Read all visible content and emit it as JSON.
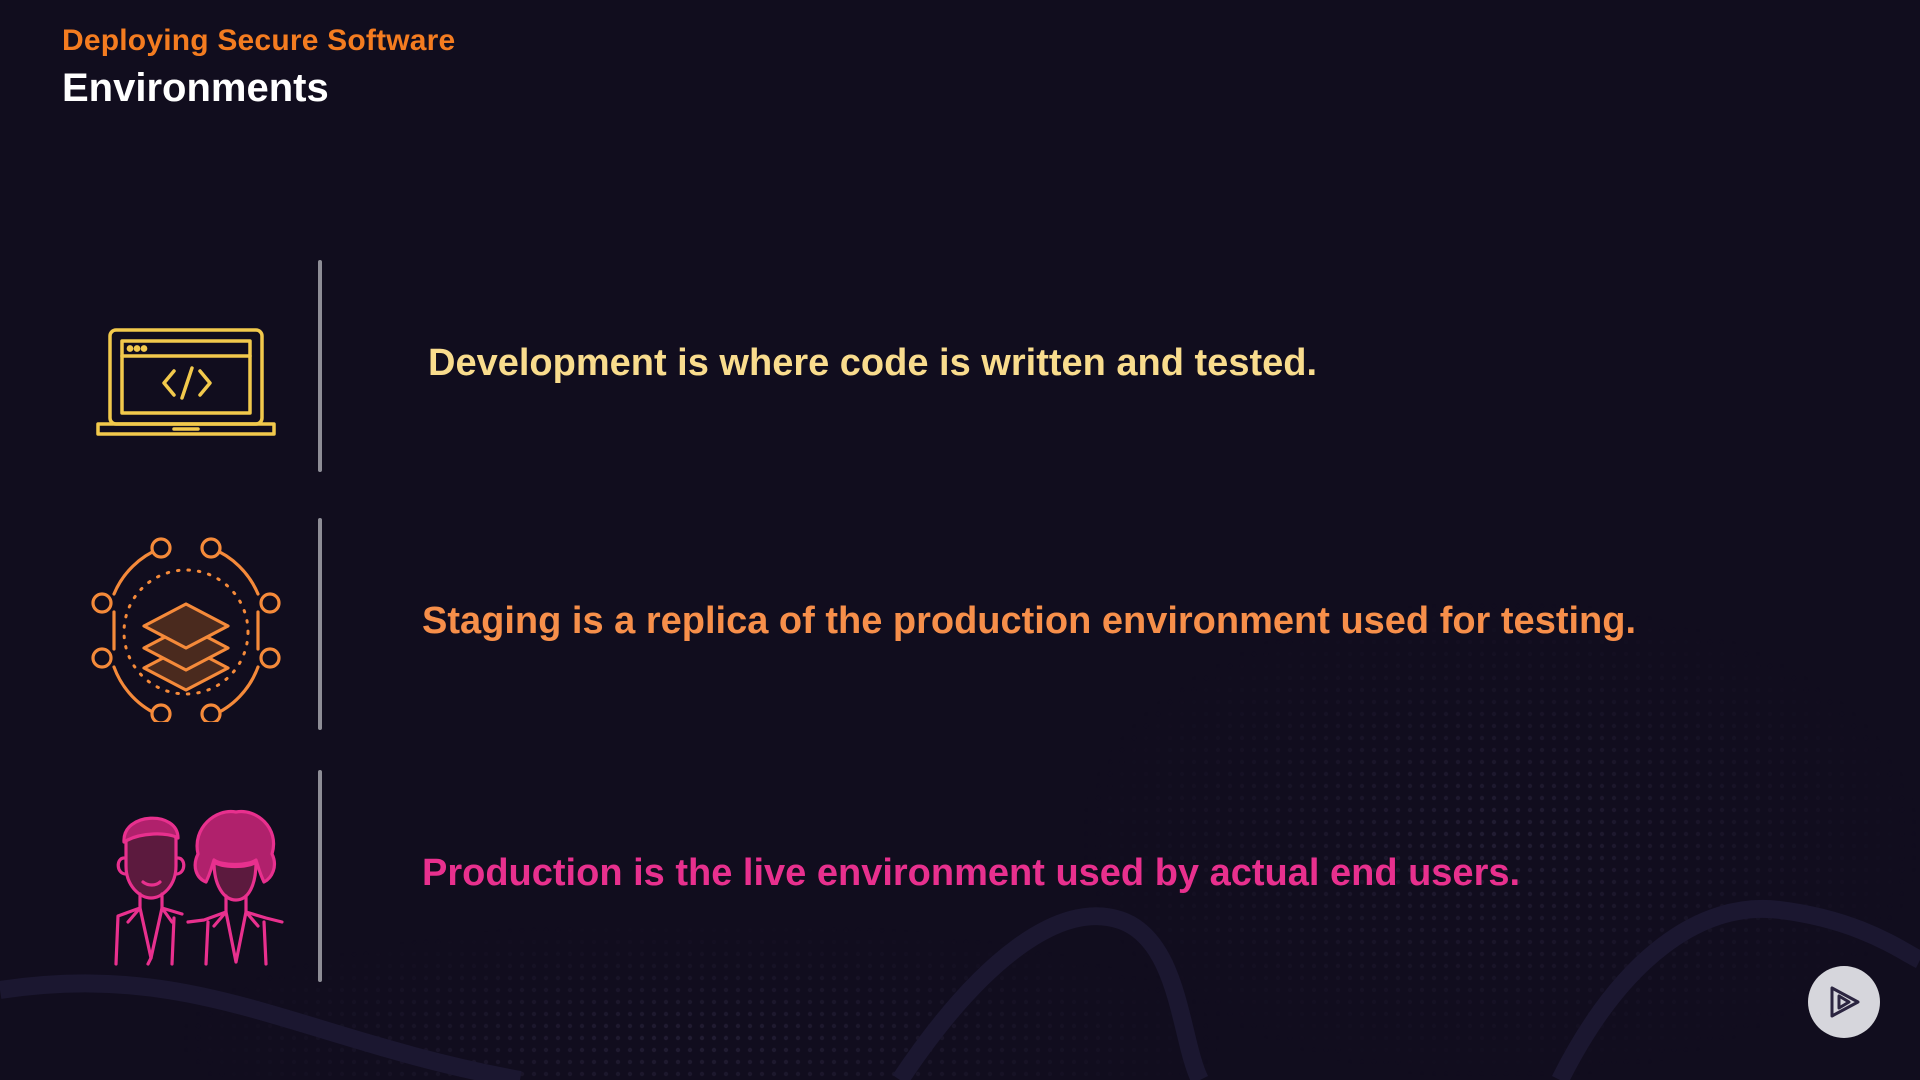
{
  "header": {
    "course_title": "Deploying Secure Software",
    "section_title": "Environments"
  },
  "rows": [
    {
      "icon": "laptop-code-icon",
      "text": "Development is where code is written and tested.",
      "color": "#f9dc8d"
    },
    {
      "icon": "layers-network-icon",
      "text": "Staging is a replica of the production environment used for testing.",
      "color": "#f78f4a"
    },
    {
      "icon": "users-icon",
      "text": "Production is the live environment used by actual end users.",
      "color": "#e8308e"
    }
  ],
  "colors": {
    "background": "#110d1e",
    "accent_orange": "#f47c20",
    "divider": "#8e8d96"
  },
  "player": {
    "icon": "play-logo-icon"
  }
}
